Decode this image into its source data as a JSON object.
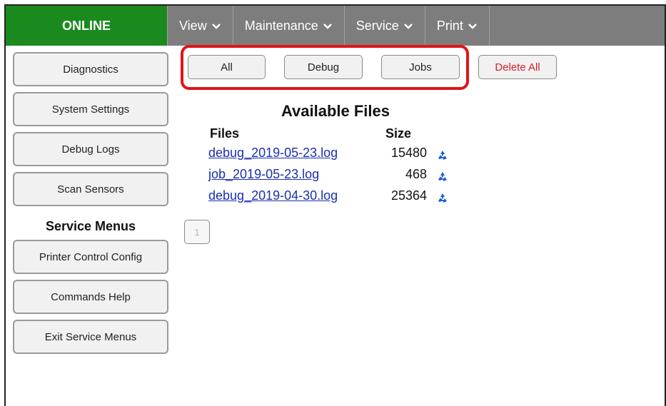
{
  "header": {
    "status": "ONLINE",
    "status_color": "#1a8a1f",
    "bar_color": "#7d7d7d",
    "menu": [
      {
        "label": "View"
      },
      {
        "label": "Maintenance"
      },
      {
        "label": "Service"
      },
      {
        "label": "Print"
      }
    ]
  },
  "sidebar": {
    "items": [
      {
        "label": "Diagnostics"
      },
      {
        "label": "System Settings"
      },
      {
        "label": "Debug Logs"
      },
      {
        "label": "Scan Sensors"
      }
    ],
    "service_title": "Service Menus",
    "service_items": [
      {
        "label": "Printer Control Config"
      },
      {
        "label": "Commands Help"
      },
      {
        "label": "Exit Service Menus"
      }
    ]
  },
  "filters": {
    "all": "All",
    "debug": "Debug",
    "jobs": "Jobs",
    "delete_all": "Delete All",
    "highlight_color": "#e0141a",
    "delete_color": "#d41f2a"
  },
  "files": {
    "title": "Available Files",
    "col_files": "Files",
    "col_size": "Size",
    "rows": [
      {
        "name": "debug_2019-05-23.log",
        "size": "15480",
        "icon": "recycle-icon"
      },
      {
        "name": "job_2019-05-23.log",
        "size": "468",
        "icon": "recycle-icon"
      },
      {
        "name": "debug_2019-04-30.log",
        "size": "25364",
        "icon": "recycle-icon"
      }
    ],
    "link_color": "#1a2fb0"
  },
  "pagination": {
    "current": "1"
  }
}
